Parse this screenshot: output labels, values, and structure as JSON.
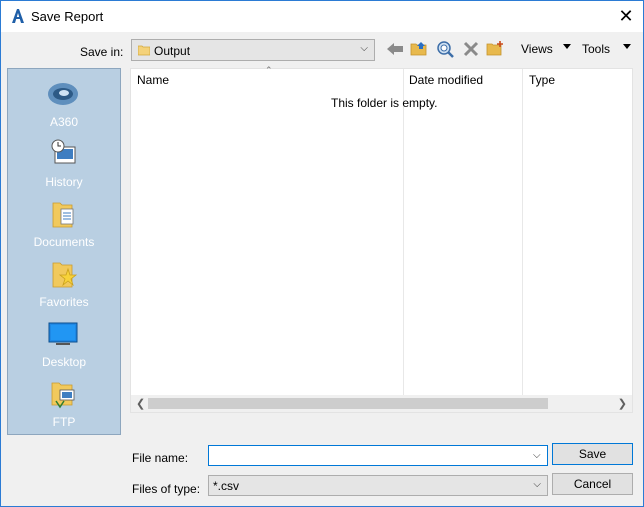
{
  "window": {
    "title": "Save Report",
    "app_icon": "autocad-a-icon",
    "close_glyph": "✕"
  },
  "toolbar": {
    "save_in_label": "Save in:",
    "save_in_value": "Output",
    "views_label": "Views",
    "tools_label": "Tools",
    "icons": [
      "back-arrow-icon",
      "up-folder-icon",
      "search-web-icon",
      "delete-icon",
      "new-folder-icon"
    ]
  },
  "places": [
    {
      "label": "A360",
      "icon": "a360-cloud-icon"
    },
    {
      "label": "History",
      "icon": "history-icon"
    },
    {
      "label": "Documents",
      "icon": "documents-folder-icon"
    },
    {
      "label": "Favorites",
      "icon": "favorites-folder-icon"
    },
    {
      "label": "Desktop",
      "icon": "desktop-monitor-icon"
    },
    {
      "label": "FTP",
      "icon": "ftp-icon"
    }
  ],
  "file_list": {
    "columns": [
      "Name",
      "Date modified",
      "Type"
    ],
    "empty_message": "This folder is empty."
  },
  "form": {
    "file_name_label": "File name:",
    "file_name_value": "",
    "files_of_type_label": "Files of type:",
    "files_of_type_value": "*.csv",
    "save_label": "Save",
    "cancel_label": "Cancel"
  },
  "colors": {
    "accent": "#0078d7",
    "places_bg": "#b9cfe2"
  }
}
